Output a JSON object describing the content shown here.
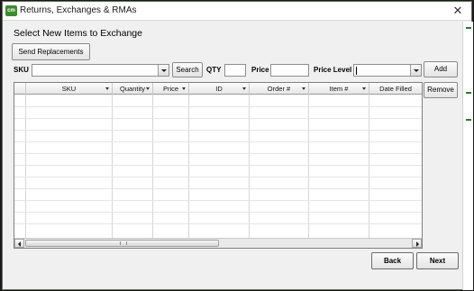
{
  "window": {
    "title": "Returns, Exchanges & RMAs",
    "icon_text": "cm",
    "close_glyph": "✕"
  },
  "heading": "Select New Items to Exchange",
  "buttons": {
    "send_replacements": "Send Replacements",
    "search": "Search",
    "add": "Add",
    "remove": "Remove",
    "back": "Back",
    "next": "Next"
  },
  "form": {
    "sku_label": "SKU",
    "sku_value": "",
    "qty_label": "QTY",
    "qty_value": "",
    "price_label": "Price",
    "price_value": "",
    "price_level_label": "Price Level",
    "price_level_value": ""
  },
  "grid": {
    "columns": [
      "SKU",
      "Quantity",
      "Price",
      "ID",
      "Order #",
      "Item #",
      "Date Filled"
    ],
    "rows": []
  },
  "icons": {
    "app": "app-logo-icon",
    "close": "close-icon",
    "dropdown": "chevron-down-icon",
    "sort": "sort-arrow-icon",
    "scroll_left": "arrow-left-icon",
    "scroll_right": "arrow-right-icon"
  }
}
